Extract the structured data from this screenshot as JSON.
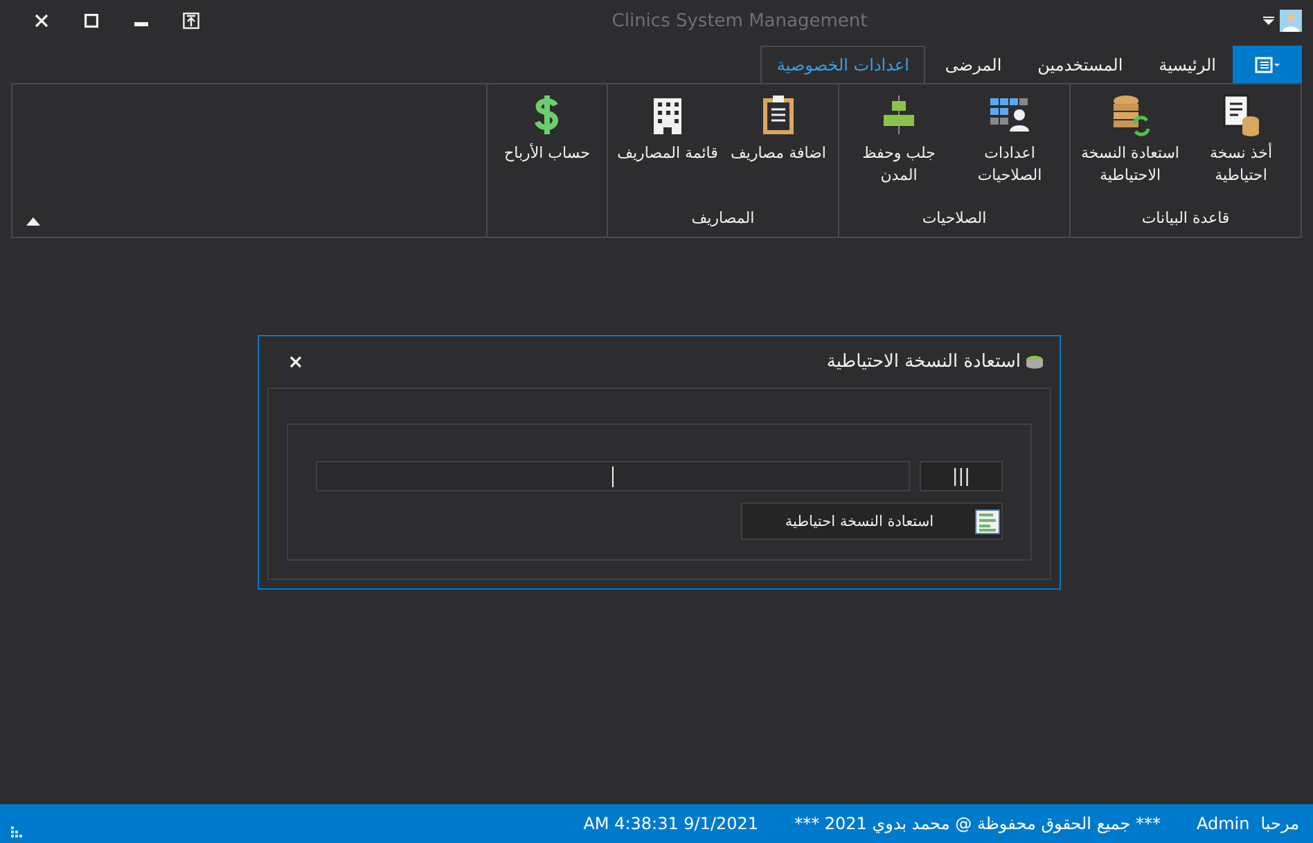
{
  "window": {
    "title": "Clinics System Management"
  },
  "tabs": [
    {
      "label": "الرئيسية",
      "selected": false
    },
    {
      "label": "المستخدمين",
      "selected": false
    },
    {
      "label": "المرضى",
      "selected": false
    },
    {
      "label": "اعدادات الخصوصية",
      "selected": true
    }
  ],
  "ribbon_groups": [
    {
      "label": "قاعدة البيانات",
      "buttons": [
        {
          "label": "أخذ نسخة احتياطية"
        },
        {
          "label": "استعادة النسخة الاحتياطية"
        }
      ]
    },
    {
      "label": "الصلاحيات",
      "buttons": [
        {
          "label": "اعدادات الصلاحيات"
        },
        {
          "label": "جلب وحفظ المدن"
        }
      ]
    },
    {
      "label": "المصاريف",
      "buttons": [
        {
          "label": "اضافة مصاريف"
        },
        {
          "label": "قائمة المصاريف"
        }
      ]
    },
    {
      "buttons": [
        {
          "label": "حساب الأرباح"
        }
      ]
    }
  ],
  "dialog": {
    "title": "استعادة النسخة الاحتياطية",
    "browse_button": "|||",
    "restore_button": "استعادة النسخة احتياطية"
  },
  "status_bar": {
    "greeting": "مرحبا",
    "user": "Admin",
    "copyright": "*** جميع الحقوق محفوظة @ محمد بدوي 2021 ***",
    "datetime": "AM 4:38:31 9/1/2021"
  }
}
